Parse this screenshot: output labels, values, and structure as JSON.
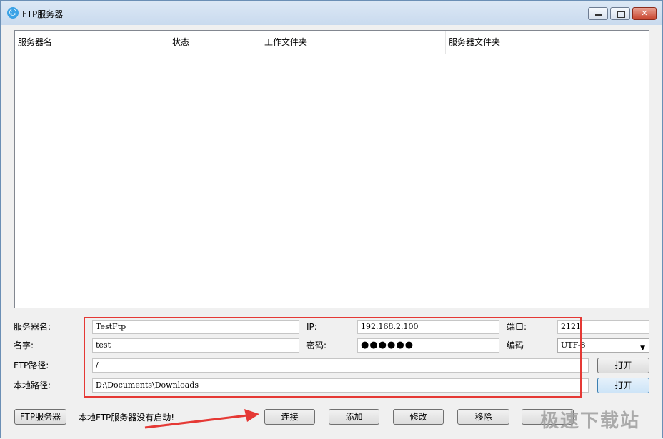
{
  "window": {
    "title": "FTP服务器"
  },
  "table": {
    "columns": [
      "服务器名",
      "状态",
      "工作文件夹",
      "服务器文件夹"
    ]
  },
  "form": {
    "server_name_label": "服务器名:",
    "server_name_value": "TestFtp",
    "ip_label": "IP:",
    "ip_value": "192.168.2.100",
    "port_label": "端口:",
    "port_value": "2121",
    "username_label": "名字:",
    "username_value": "test",
    "password_label": "密码:",
    "password_value": "●●●●●●",
    "encoding_label": "编码",
    "encoding_value": "UTF-8",
    "ftp_path_label": "FTP路径:",
    "ftp_path_value": "/",
    "local_path_label": "本地路径:",
    "local_path_value": "D:\\Documents\\Downloads",
    "open_label": "打开"
  },
  "footer": {
    "ftp_server_button": "FTP服务器",
    "status_text": "本地FTP服务器没有启动!",
    "connect": "连接",
    "add": "添加",
    "modify": "修改",
    "remove": "移除",
    "watermark": "极速下载站"
  }
}
